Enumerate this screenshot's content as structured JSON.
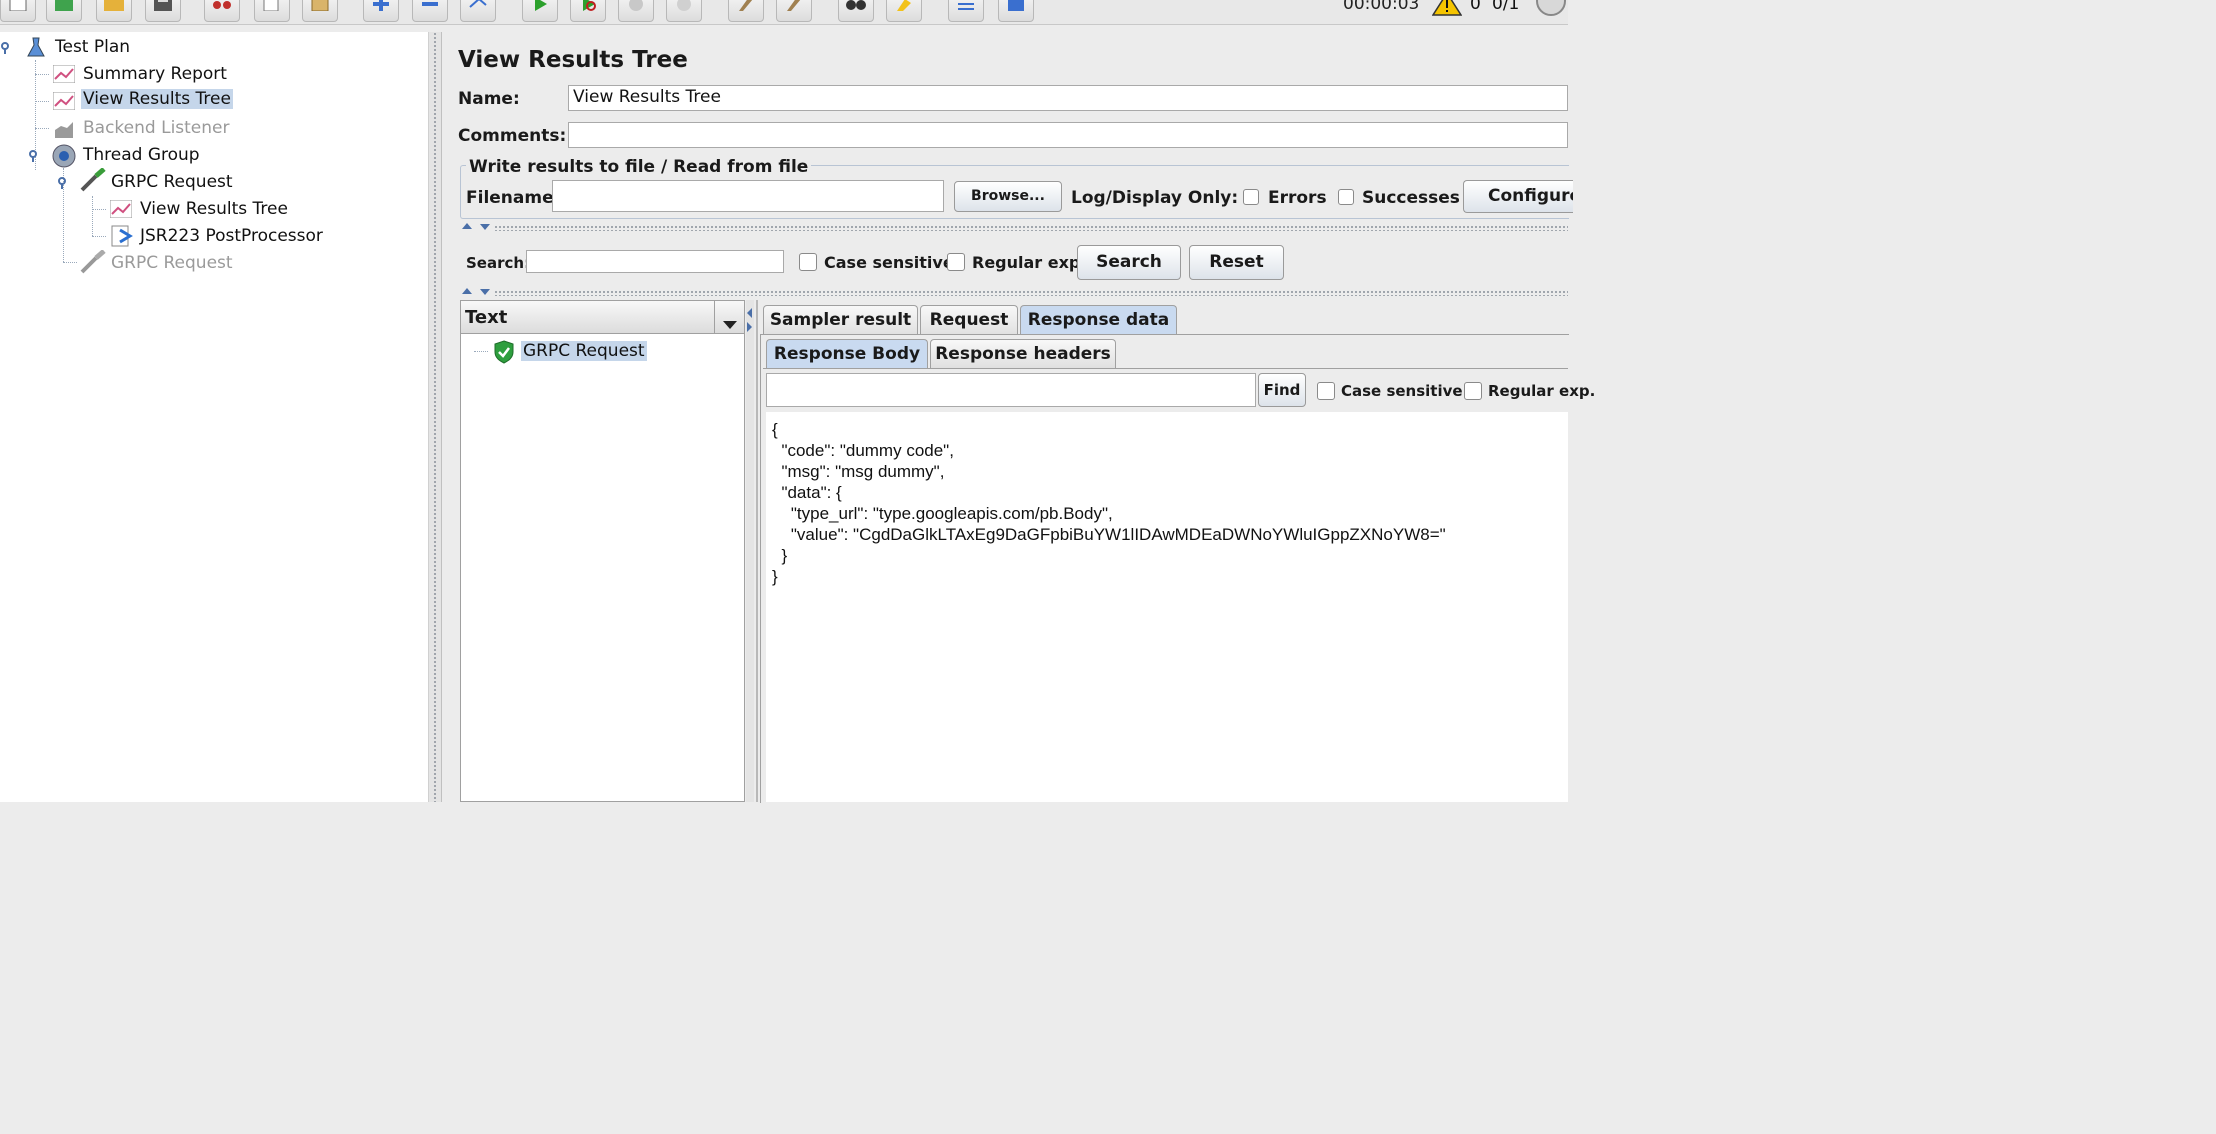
{
  "toolbar": {
    "timer": "00:00:03",
    "warning_count": "0",
    "thread_count": "0/1"
  },
  "tree": {
    "items": [
      {
        "label": "Test Plan",
        "icon": "flask-icon"
      },
      {
        "label": "Summary Report",
        "icon": "chart-icon"
      },
      {
        "label": "View Results Tree",
        "icon": "chart-icon",
        "selected": true
      },
      {
        "label": "Backend Listener",
        "icon": "bar-chart-icon",
        "disabled": true
      },
      {
        "label": "Thread Group",
        "icon": "gear-icon"
      },
      {
        "label": "GRPC Request",
        "icon": "pipette-icon"
      },
      {
        "label": "View Results Tree",
        "icon": "chart-icon"
      },
      {
        "label": "JSR223 PostProcessor",
        "icon": "document-arrow-icon"
      },
      {
        "label": "GRPC Request",
        "icon": "pipette-icon",
        "disabled": true
      }
    ]
  },
  "main": {
    "title": "View Results Tree",
    "name_label": "Name:",
    "name_value": "View Results Tree",
    "comments_label": "Comments:",
    "comments_value": "",
    "file_group": {
      "legend": "Write results to file / Read from file",
      "filename_label": "Filename",
      "filename_value": "",
      "browse_label": "Browse...",
      "log_display_label": "Log/Display Only:",
      "errors_label": "Errors",
      "successes_label": "Successes",
      "configure_label": "Configure"
    },
    "search": {
      "label": "Search:",
      "value": "",
      "case_sensitive_label": "Case sensitive",
      "regex_label": "Regular exp.",
      "search_button": "Search",
      "reset_button": "Reset"
    },
    "renderer": {
      "selected": "Text"
    },
    "results": [
      {
        "label": "GRPC Request",
        "status": "success"
      }
    ],
    "tabs": [
      {
        "label": "Sampler result"
      },
      {
        "label": "Request"
      },
      {
        "label": "Response data",
        "active": true
      }
    ],
    "subtabs": [
      {
        "label": "Response Body",
        "active": true
      },
      {
        "label": "Response headers"
      }
    ],
    "find": {
      "value": "",
      "find_button": "Find",
      "case_sensitive_label": "Case sensitive",
      "regex_label": "Regular exp."
    },
    "response_body": "{\n  \"code\": \"dummy code\",\n  \"msg\": \"msg dummy\",\n  \"data\": {\n    \"type_url\": \"type.googleapis.com/pb.Body\",\n    \"value\": \"CgdDaGlkLTAxEg9DaGFpbiBuYW1lIDAwMDEaDWNoYWluIGppZXNoYW8=\"\n  }\n}"
  },
  "colors": {
    "selection": "#c5d6ea",
    "active_tab": "#c9daf0",
    "success": "#2e9e3e",
    "accent": "#4a6fa8"
  }
}
